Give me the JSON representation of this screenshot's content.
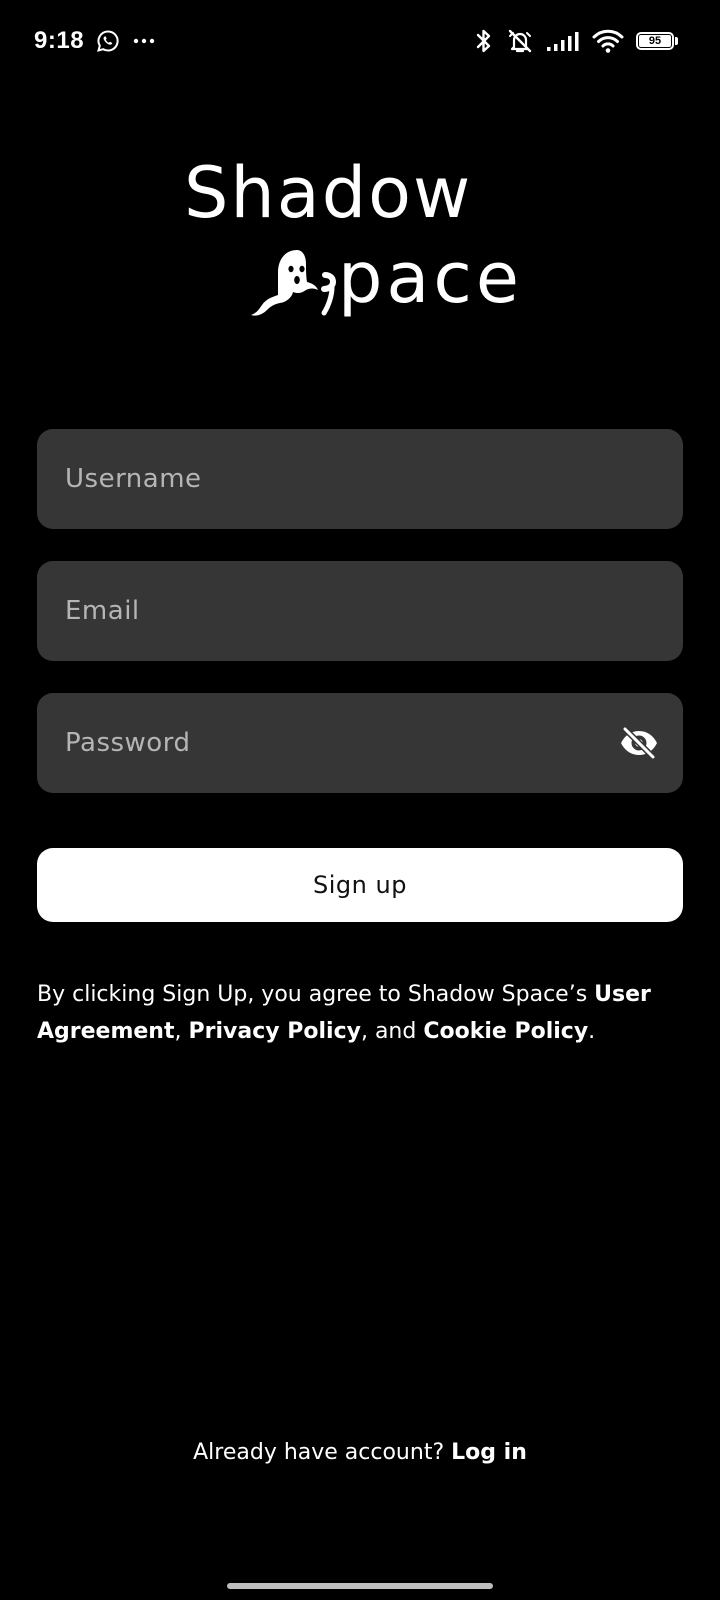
{
  "status_bar": {
    "time": "9:18",
    "battery_level": "95",
    "left_icons": [
      "whatsapp-icon",
      "more-dots-icon"
    ],
    "right_icons": [
      "bluetooth-icon",
      "alarm-off-icon",
      "signal-icon",
      "wifi-icon",
      "battery-icon"
    ]
  },
  "logo": {
    "line1": "Shadow",
    "line2": "pace",
    "mascot_icon": "ghost-icon"
  },
  "form": {
    "username_placeholder": "Username",
    "email_placeholder": "Email",
    "password_placeholder": "Password",
    "password_toggle_icon": "eye-off-icon",
    "signup_label": "Sign up"
  },
  "terms": {
    "prefix": "By clicking Sign Up, you agree to Shadow Space’s ",
    "user_agreement": "User Agreement",
    "sep1": ", ",
    "privacy_policy": "Privacy Policy",
    "sep2": ", and ",
    "cookie_policy": "Cookie Policy",
    "suffix": "."
  },
  "login": {
    "prompt": "Already have account? ",
    "link": "Log in"
  },
  "colors": {
    "background": "#000000",
    "field_background": "#363636",
    "placeholder": "#b5b5b5",
    "button_background": "#ffffff",
    "button_text": "#111111"
  }
}
